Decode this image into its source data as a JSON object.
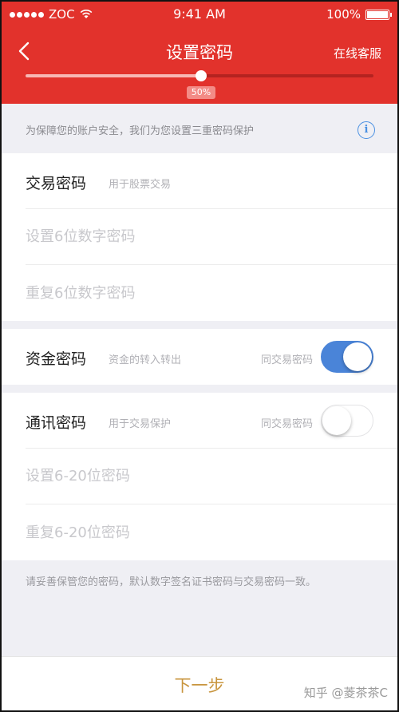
{
  "status_bar": {
    "carrier": "ZOC",
    "time": "9:41 AM",
    "battery": "100%"
  },
  "nav": {
    "title": "设置密码",
    "right_link": "在线客服",
    "back_icon": "chevron-left-icon"
  },
  "progress": {
    "value": 0.5,
    "label": "50%"
  },
  "tip": {
    "text": "为保障您的账户安全，我们为您设置三重密码保护",
    "info_icon": "info-icon",
    "info_glyph": "i"
  },
  "trade_password": {
    "title": "交易密码",
    "subtitle": "用于股票交易",
    "field1_placeholder": "设置6位数字密码",
    "field2_placeholder": "重复6位数字密码"
  },
  "fund_password": {
    "title": "资金密码",
    "subtitle": "资金的转入转出",
    "same_label": "同交易密码",
    "same_enabled": true
  },
  "comm_password": {
    "title": "通讯密码",
    "subtitle": "用于交易保护",
    "same_label": "同交易密码",
    "same_enabled": false,
    "field1_placeholder": "设置6-20位密码",
    "field2_placeholder": "重复6-20位密码"
  },
  "note": "请妥善保管您的密码，默认数字签名证书密码与交易密码一致。",
  "bottom": {
    "next_label": "下一步",
    "watermark": "知乎 @菱茶茶C"
  },
  "colors": {
    "header": "#e2322c",
    "switch_on": "#4a84d8",
    "next_text": "#c8953e"
  }
}
